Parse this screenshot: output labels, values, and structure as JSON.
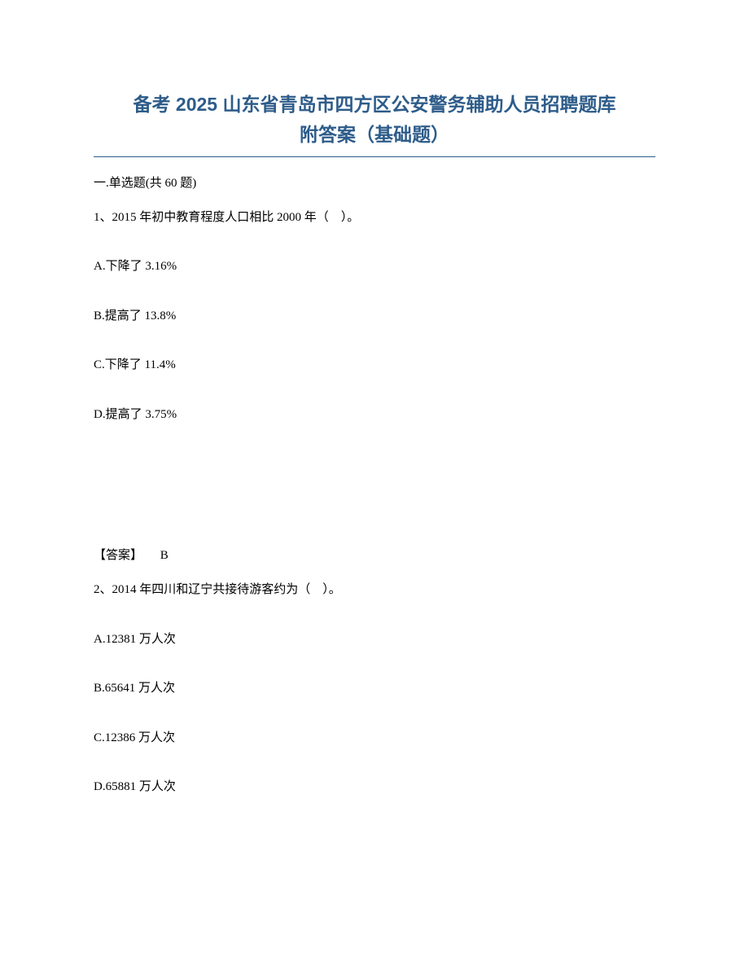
{
  "title": {
    "line1": "备考 2025 山东省青岛市四方区公安警务辅助人员招聘题库",
    "line2": "附答案（基础题）"
  },
  "section_header": "一.单选题(共 60 题)",
  "question1": {
    "text": "1、2015 年初中教育程度人口相比 2000 年（　）。",
    "options": {
      "a": "A.下降了 3.16%",
      "b": "B.提高了 13.8%",
      "c": "C.下降了 11.4%",
      "d": "D.提高了 3.75%"
    },
    "answer_label": "【答案】",
    "answer_value": "B"
  },
  "question2": {
    "text": "2、2014 年四川和辽宁共接待游客约为（　）。",
    "options": {
      "a": "A.12381 万人次",
      "b": "B.65641 万人次",
      "c": "C.12386 万人次",
      "d": "D.65881 万人次"
    }
  }
}
